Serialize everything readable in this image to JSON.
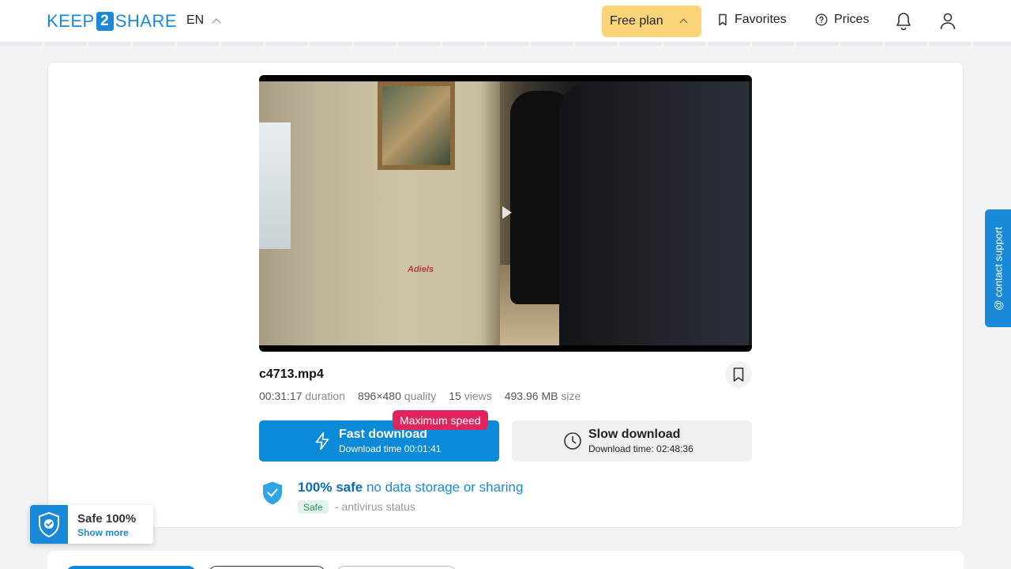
{
  "header": {
    "logo": {
      "left": "KEEP",
      "mid": "2",
      "right": "SHARE"
    },
    "language": "EN",
    "free_plan": "Free plan",
    "favorites": "Favorites",
    "prices": "Prices",
    "icons": [
      "bookmark-icon",
      "help-circle-icon",
      "bell-icon",
      "user-icon"
    ]
  },
  "video": {
    "watermark": "Adiels"
  },
  "file": {
    "name": "c4713.mp4",
    "meta": [
      {
        "value": "00:31:17",
        "label": "duration"
      },
      {
        "value": "896×480",
        "label": "quality"
      },
      {
        "value": "15",
        "label": "views"
      },
      {
        "value": "493.96 MB",
        "label": "size"
      }
    ]
  },
  "download": {
    "badge": "Maximum speed",
    "fast": {
      "title": "Fast download",
      "subtitle": "Download time 00:01:41"
    },
    "slow": {
      "title": "Slow download",
      "subtitle": "Download time: 02:48:36"
    }
  },
  "safety": {
    "bold": "100% safe",
    "rest": "no data storage or sharing",
    "tag": "Safe",
    "status": "- antivirus status"
  },
  "support": {
    "label": "@ contact support"
  },
  "safe_widget": {
    "title": "Safe 100%",
    "link": "Show more"
  },
  "colors": {
    "accent": "#0b8ad7",
    "free_plan": "#fbd47a",
    "badge": "#e0245e"
  }
}
